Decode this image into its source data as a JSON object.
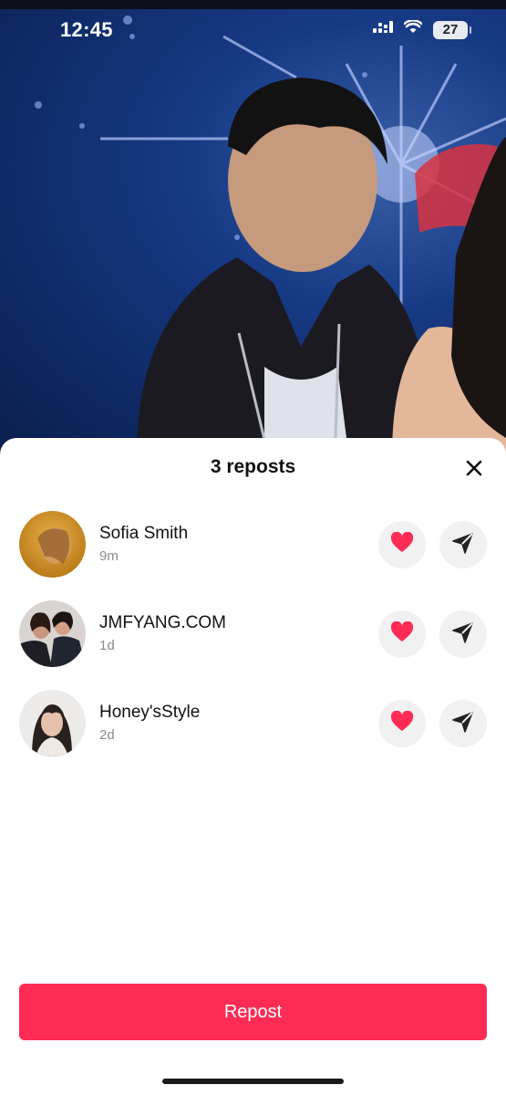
{
  "status_bar": {
    "time": "12:45",
    "battery": "27",
    "icons": [
      "cellular-signal-icon",
      "wifi-icon",
      "battery-icon"
    ]
  },
  "sheet": {
    "title": "3 reposts",
    "close_icon": "close-icon"
  },
  "reposts": [
    {
      "name": "Sofia Smith",
      "time": "9m"
    },
    {
      "name": "JMFYANG.COM",
      "time": "1d"
    },
    {
      "name": "Honey'sStyle",
      "time": "2d"
    }
  ],
  "actions": {
    "like_icon": "heart-icon",
    "share_icon": "send-icon"
  },
  "repost_button": {
    "label": "Repost"
  },
  "colors": {
    "accent": "#fe2c55",
    "heart": "#fe2c55",
    "button_bg": "#f1f1f2",
    "subtext": "#8a8a8a"
  }
}
